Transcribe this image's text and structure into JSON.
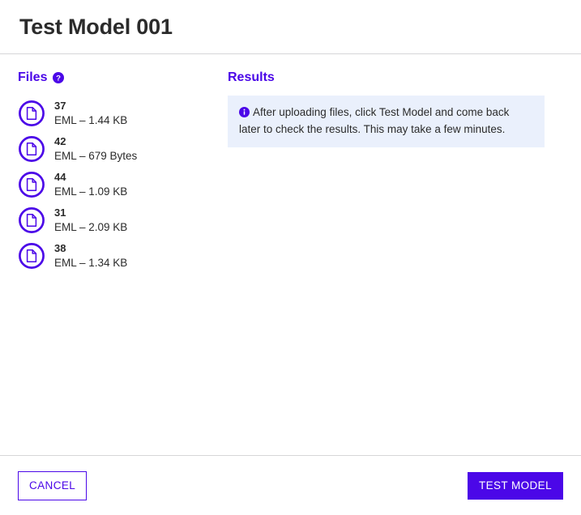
{
  "header": {
    "title": "Test Model 001"
  },
  "files_panel": {
    "heading": "Files",
    "help_icon": "help-circle-icon",
    "items": [
      {
        "name": "37",
        "meta": "EML – 1.44 KB",
        "icon": "document-icon"
      },
      {
        "name": "42",
        "meta": "EML – 679 Bytes",
        "icon": "document-icon"
      },
      {
        "name": "44",
        "meta": "EML – 1.09 KB",
        "icon": "document-icon"
      },
      {
        "name": "31",
        "meta": "EML – 2.09 KB",
        "icon": "document-icon"
      },
      {
        "name": "38",
        "meta": "EML – 1.34 KB",
        "icon": "document-icon"
      }
    ]
  },
  "results_panel": {
    "heading": "Results",
    "alert": {
      "icon": "info-circle-icon",
      "text": "After uploading files, click Test Model and come back later to check the results. This may take a few minutes."
    }
  },
  "footer": {
    "cancel_label": "CANCEL",
    "submit_label": "TEST MODEL"
  },
  "colors": {
    "accent": "#4B07E8",
    "title_text": "#2b2b2b",
    "alert_background": "#eaf0fc",
    "divider": "#d6d6d8",
    "page_background": "#ffffff"
  }
}
